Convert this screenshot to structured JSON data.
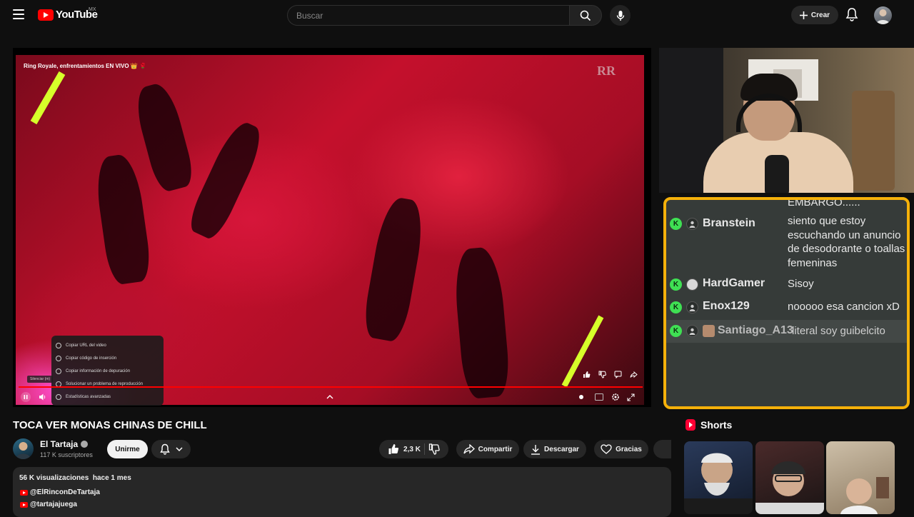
{
  "header": {
    "logo_text": "YouTube",
    "country_code": "MX",
    "search_placeholder": "Buscar",
    "create_label": "Crear"
  },
  "player": {
    "overlay_title": "Ring Royale, enfrentamientos EN VIVO 👑 🌹",
    "progress_fraction": 1.0,
    "mute_tooltip": "Silenciar (m)",
    "context_menu": [
      "Copiar URL del video",
      "Copiar código de inserción",
      "Copiar información de depuración",
      "Solucionar un problema de reproducción",
      "Estadísticas avanzadas"
    ]
  },
  "video": {
    "title": "TOCA VER MONAS CHINAS DE CHILL",
    "channel_name": "El Tartaja",
    "subscribers": "117 K suscriptores",
    "join_label": "Unirme",
    "likes": "2,3 K",
    "share_label": "Compartir",
    "download_label": "Descargar",
    "thanks_label": "Gracias",
    "views": "56 K visualizaciones",
    "age": "hace 1 mes",
    "links": [
      "@ElRinconDeTartaja",
      "@tartajajuega"
    ]
  },
  "chat": {
    "partial_top": "EMBARGO......",
    "messages": [
      {
        "name": "Branstein",
        "text": "siento que estoy escuchando un anuncio de desodorante o toallas femeninas"
      },
      {
        "name": "HardGamer",
        "text": "Sisoy"
      },
      {
        "name": "Enox129",
        "text": "nooooo esa cancion xD"
      },
      {
        "name": "Santiago_A13",
        "text": "literal soy guibelcito"
      }
    ],
    "badge_letter": "K",
    "border_color": "#f5b10a",
    "badge_color": "#3fe053"
  },
  "shorts": {
    "title": "Shorts"
  },
  "colors": {
    "background": "#0f0f0f",
    "brand_red": "#ff0000"
  }
}
